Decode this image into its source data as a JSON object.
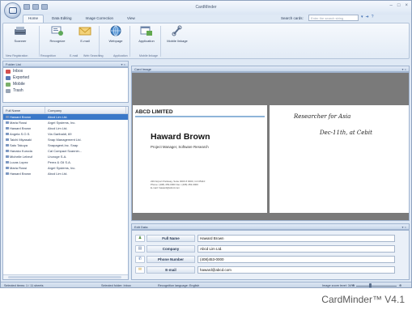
{
  "app": {
    "title": "CardMinder",
    "caption": "CardMinder™ V4.1"
  },
  "titlebar": {
    "minimize": "–",
    "maximize": "□",
    "close": "×"
  },
  "tabs": [
    "Home",
    "Data Editing",
    "Image Correction",
    "View"
  ],
  "search": {
    "label": "Search cards:",
    "placeholder": "Enter the search string"
  },
  "ribbon": {
    "buttons": [
      {
        "label": "Scanner",
        "icon": "scanner-icon"
      },
      {
        "label": "Recognize",
        "icon": "recognize-icon"
      },
      {
        "label": "E-mail",
        "icon": "email-icon"
      },
      {
        "label": "Webpage",
        "icon": "globe-icon"
      },
      {
        "label": "Application",
        "icon": "application-icon"
      },
      {
        "label": "Mobile linkage",
        "icon": "mobile-link-icon"
      }
    ],
    "groups": [
      "New Registration",
      "Recognition",
      "E-mail",
      "Web Searching",
      "Application",
      "Mobile linkage"
    ]
  },
  "folders": {
    "header": "Folder List",
    "items": [
      {
        "label": "Inbox",
        "color": "#d45050"
      },
      {
        "label": "Exported",
        "color": "#5a7ab8"
      },
      {
        "label": "Mobile",
        "color": "#7bb06a"
      },
      {
        "label": "Trash",
        "color": "#9aa6b6"
      }
    ]
  },
  "cardlist": {
    "columns": [
      "Full Name",
      "Company"
    ],
    "rows": [
      [
        "Haward Brown",
        "Abcd Lim Ltd."
      ],
      [
        "Maria Rossi",
        "Argel Systems, Inc."
      ],
      [
        "Haward Brown",
        "Abcd Lim Ltd."
      ],
      [
        "Angela S.O.S.",
        "Via Garibaldi, 69"
      ],
      [
        "Taichi Miyasaki",
        "Snap Management Ltd."
      ],
      [
        "Sato Takuya",
        "Snapagent,Inc. Snap"
      ],
      [
        "Hanako Kuroda",
        "Cal Compact Scannin..."
      ],
      [
        "Michelle Lebeuf",
        "Lhoroge S.A."
      ],
      [
        "Lucas Lopez",
        "Perez & Gil S.A."
      ],
      [
        "Maria Rossi",
        "Argel Systems, Inc."
      ],
      [
        "Haward Brown",
        "Abcd Lim Ltd."
      ]
    ],
    "selected_index": 0
  },
  "card_image": {
    "header": "Card Image",
    "company": "ABCD LIMITED",
    "person": "Haward Brown",
    "title": "Project Manager, Software Research",
    "address": [
      "220 Airport Parkway, Suite 0000 # 0000, CA 95110",
      "Phone: (408) 453-0000    Fax: (408) 453-0000",
      "E-mail: haward@abcd.com"
    ],
    "handwriting": [
      "Researcher for Asia",
      "Dec-11th, at Cebit"
    ]
  },
  "edit_data": {
    "header": "Edit Data",
    "fields": [
      {
        "label": "Full Name",
        "value": "Haward Brown",
        "icon": "person-icon"
      },
      {
        "label": "Company",
        "value": "Abcd Lim Ltd.",
        "icon": "company-icon"
      },
      {
        "label": "Phone Number",
        "value": "(408)453-0000",
        "icon": "phone-icon"
      },
      {
        "label": "E-mail",
        "value": "haward@abcd.com",
        "icon": "envelope-icon"
      }
    ]
  },
  "status": {
    "selected_items": "Selected items:  1  /  11 sheets",
    "selected_folder": "Selected folder: Inbox",
    "language": "Recognition language: English",
    "zoom": "Image zoom level: 34%"
  }
}
